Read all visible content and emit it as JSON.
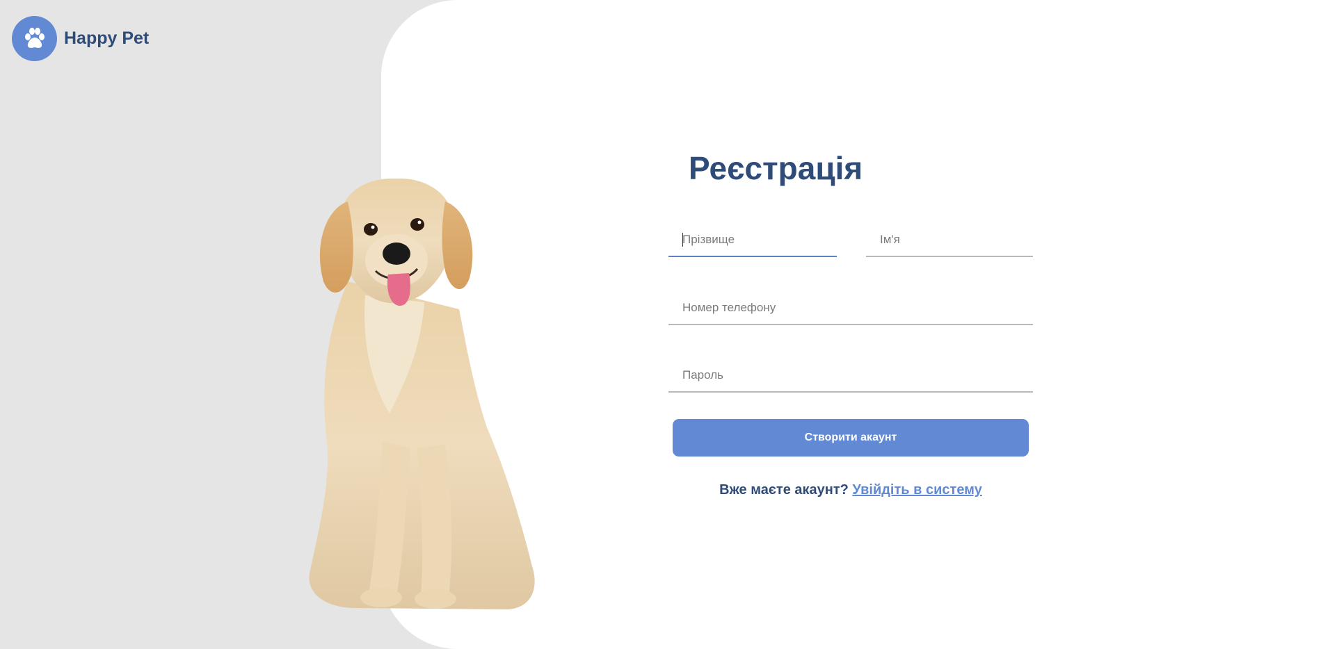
{
  "brand": {
    "name": "Happy Pet",
    "accent_color": "#6189d4",
    "text_color": "#2f4b78"
  },
  "form": {
    "title": "Реєстрація",
    "fields": {
      "last_name": {
        "placeholder": "Прізвище",
        "value": ""
      },
      "first_name": {
        "placeholder": "Ім'я",
        "value": ""
      },
      "phone": {
        "placeholder": "Номер телефону",
        "value": ""
      },
      "password": {
        "placeholder": "Пароль",
        "value": ""
      }
    },
    "submit_label": "Створити акаунт",
    "login_prompt": "Вже маєте акаунт?",
    "login_link": "Увійдіть в систему"
  },
  "illustration": {
    "icon": "paw-icon",
    "image": "golden-retriever-dog-image"
  }
}
